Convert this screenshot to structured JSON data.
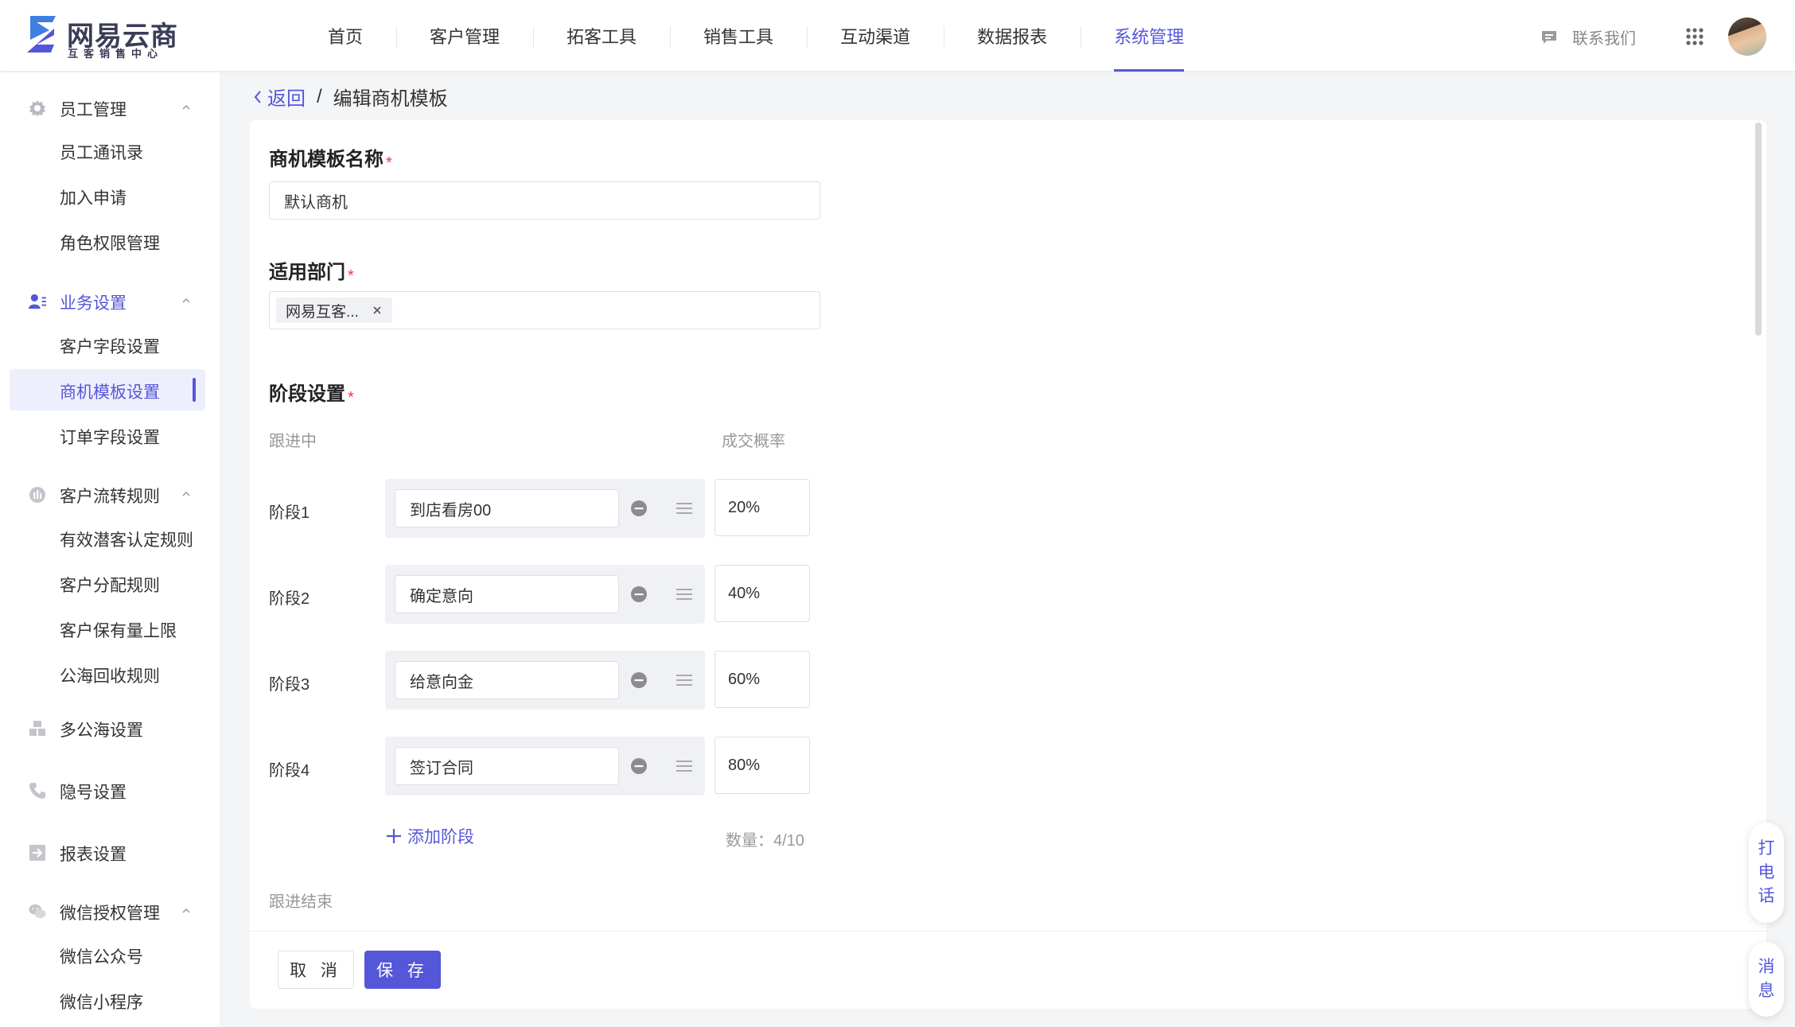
{
  "header": {
    "brand_name": "网易云商",
    "brand_sub": "互客销售中心",
    "nav": [
      {
        "label": "首页"
      },
      {
        "label": "客户管理"
      },
      {
        "label": "拓客工具"
      },
      {
        "label": "销售工具"
      },
      {
        "label": "互动渠道"
      },
      {
        "label": "数据报表"
      },
      {
        "label": "系统管理",
        "active": true
      }
    ],
    "contact_label": "联系我们",
    "accent_color": "#5457d8"
  },
  "sidebar": {
    "groups": [
      {
        "label": "员工管理",
        "icon": "gear-icon",
        "items": [
          {
            "label": "员工通讯录"
          },
          {
            "label": "加入申请"
          },
          {
            "label": "角色权限管理"
          }
        ]
      },
      {
        "label": "业务设置",
        "icon": "user-list-icon",
        "items": [
          {
            "label": "客户字段设置"
          },
          {
            "label": "商机模板设置",
            "active": true
          },
          {
            "label": "订单字段设置"
          }
        ]
      },
      {
        "label": "客户流转规则",
        "icon": "flow-icon",
        "items": [
          {
            "label": "有效潜客认定规则"
          },
          {
            "label": "客户分配规则"
          },
          {
            "label": "客户保有量上限"
          },
          {
            "label": "公海回收规则"
          }
        ]
      },
      {
        "label": "多公海设置",
        "icon": "boxes-icon",
        "items": []
      },
      {
        "label": "隐号设置",
        "icon": "phone-icon",
        "items": []
      },
      {
        "label": "报表设置",
        "icon": "report-icon",
        "items": []
      },
      {
        "label": "微信授权管理",
        "icon": "wechat-icon",
        "items": [
          {
            "label": "微信公众号"
          },
          {
            "label": "微信小程序"
          }
        ]
      }
    ]
  },
  "breadcrumb": {
    "back_label": "返回",
    "separator": "/",
    "current": "编辑商机模板"
  },
  "form": {
    "name_label": "商机模板名称",
    "name_value": "默认商机",
    "dept_label": "适用部门",
    "dept_tags": [
      "网易互客..."
    ],
    "stage_label": "阶段设置",
    "required_mark": "*",
    "in_progress_label": "跟进中",
    "probability_label": "成交概率",
    "stages": [
      {
        "label": "阶段1",
        "name": "到店看房00",
        "probability": "20%"
      },
      {
        "label": "阶段2",
        "name": "确定意向",
        "probability": "40%"
      },
      {
        "label": "阶段3",
        "name": "给意向金",
        "probability": "60%"
      },
      {
        "label": "阶段4",
        "name": "签订合同",
        "probability": "80%"
      }
    ],
    "add_stage_label": "添加阶段",
    "count_text": "数量：4/10",
    "ended_label": "跟进结束"
  },
  "footer": {
    "cancel_label": "取 消",
    "save_label": "保 存"
  },
  "floating": {
    "call_label": [
      "打",
      "电",
      "话"
    ],
    "msg_label": [
      "消",
      "息"
    ]
  }
}
